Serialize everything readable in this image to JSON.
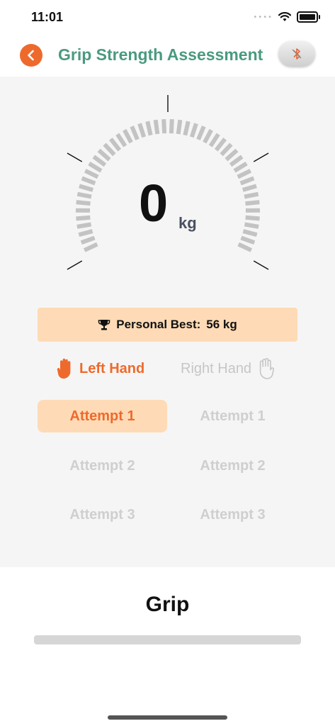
{
  "status_bar": {
    "time": "11:01"
  },
  "header": {
    "title": "Grip Strength Assessment"
  },
  "gauge": {
    "value": "0",
    "unit": "kg",
    "level": 0
  },
  "personal_best": {
    "label": "Personal Best:",
    "value": "56 kg"
  },
  "hands": {
    "left": "Left Hand",
    "right": "Right Hand",
    "selected": "left"
  },
  "attempts": {
    "left": [
      "Attempt 1",
      "Attempt 2",
      "Attempt 3"
    ],
    "right": [
      "Attempt 1",
      "Attempt 2",
      "Attempt 3"
    ],
    "active": "left-1"
  },
  "grip": {
    "label": "Grip",
    "progress": 0
  },
  "colors": {
    "accent": "#ee6a2c",
    "title": "#4a9a7f",
    "highlight": "#fedbb6",
    "inactive": "#c6c6c6"
  }
}
